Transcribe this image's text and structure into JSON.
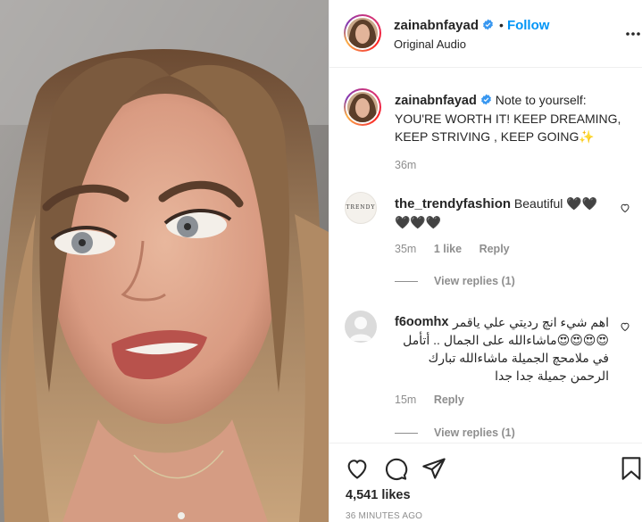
{
  "post": {
    "author": "zainabnfayad",
    "audio": "Original Audio",
    "dot": "•",
    "follow_label": "Follow",
    "caption": {
      "username": "zainabnfayad",
      "text": "Note to yourself: YOU'RE WORTH IT! KEEP DREAMING, KEEP STRIVING , KEEP GOING✨",
      "time": "36m"
    },
    "comments": [
      {
        "username": "the_trendyfashion",
        "avatar_text": "TRENDY",
        "text": "Beautiful 🖤🖤🖤🖤🖤",
        "time": "35m",
        "likes": "1 like",
        "reply_label": "Reply",
        "view_replies": "View replies (1)"
      },
      {
        "username": "f6oomhx",
        "text": "اهم شيء انچ رديتي علي ياقمر 😍😍😍😍ماشاءالله على الجمال .. أتأمل في ملامحچ الجميلة ماشاءالله تبارك الرحمن جميلة جدا جدا",
        "time": "15m",
        "reply_label": "Reply",
        "view_replies": "View replies (1)"
      }
    ],
    "likes_count": "4,541 likes",
    "posted_ago": "36 MINUTES AGO"
  },
  "colors": {
    "link_blue": "#0095f6",
    "verified_blue": "#3897f0",
    "muted_text": "#8e8e8e",
    "border": "#efefef"
  },
  "icons": {
    "more": "more-options-icon",
    "heart": "heart-icon",
    "comment": "comment-icon",
    "share": "share-icon",
    "save": "bookmark-icon",
    "verified": "verified-badge-icon"
  }
}
